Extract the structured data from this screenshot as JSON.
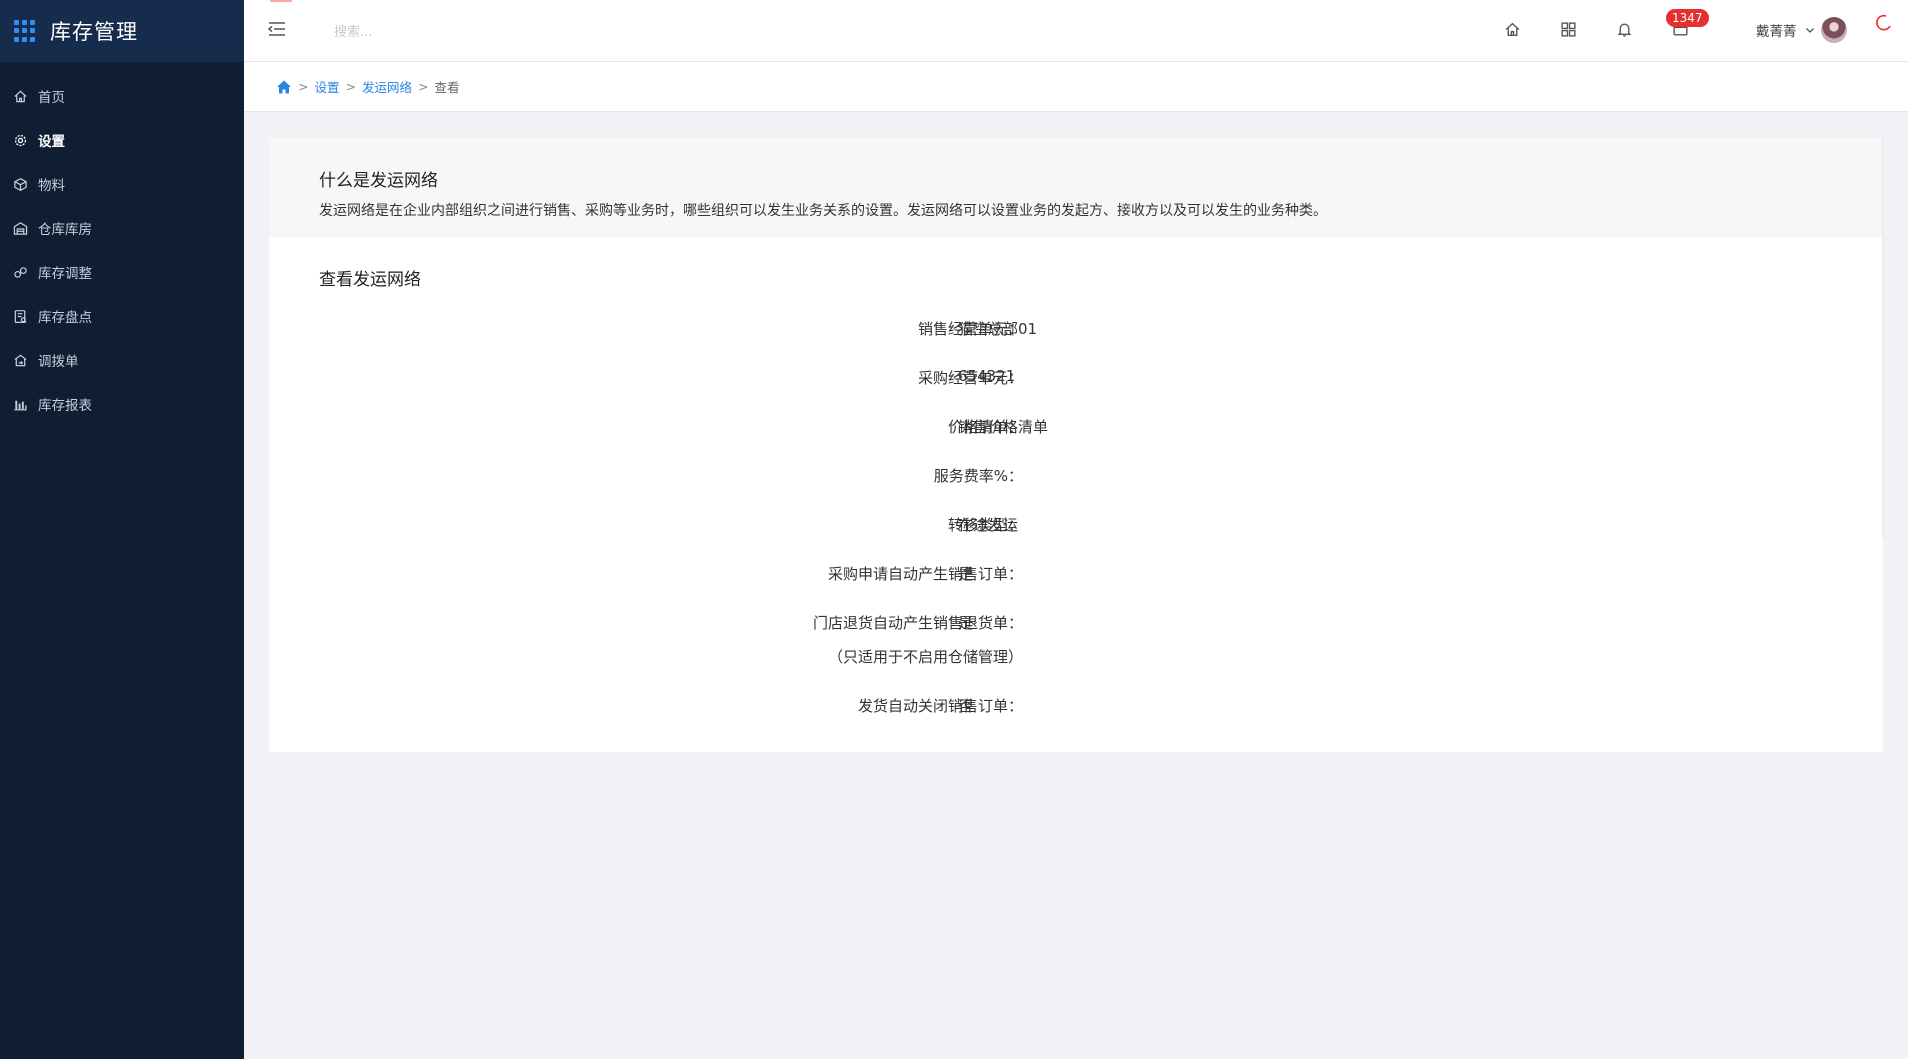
{
  "app": {
    "title": "库存管理"
  },
  "sidebar": {
    "items": [
      {
        "label": "首页",
        "icon": "home-icon",
        "active": false
      },
      {
        "label": "设置",
        "icon": "gear-icon",
        "active": true
      },
      {
        "label": "物料",
        "icon": "cube-icon",
        "active": false
      },
      {
        "label": "仓库库房",
        "icon": "warehouse-icon",
        "active": false
      },
      {
        "label": "库存调整",
        "icon": "adjust-icon",
        "active": false
      },
      {
        "label": "库存盘点",
        "icon": "inventory-check-icon",
        "active": false
      },
      {
        "label": "调拨单",
        "icon": "transfer-icon",
        "active": false
      },
      {
        "label": "库存报表",
        "icon": "bar-chart-icon",
        "active": false
      }
    ]
  },
  "topbar": {
    "search_placeholder": "搜索...",
    "notification_badge": "1347",
    "user_name": "戴菁菁"
  },
  "breadcrumb": {
    "items": [
      "设置",
      "发运网络"
    ],
    "current": "查看"
  },
  "info": {
    "title": "什么是发运网络",
    "description": "发运网络是在企业内部组织之间进行销售、采购等业务时，哪些组织可以发生业务关系的设置。发运网络可以设置业务的发起方、接收方以及可以发生的业务种类。"
  },
  "detail": {
    "title": "查看发运网络",
    "rows": [
      {
        "label": "销售经营单元：",
        "value": "猫空总部01"
      },
      {
        "label": "采购经营单元：",
        "value": "654321"
      },
      {
        "label": "价格清单：",
        "value": "销售价格清单"
      },
      {
        "label": "服务费率%：",
        "value": ""
      },
      {
        "label": "转移类型：",
        "value": "在途发运"
      },
      {
        "label": "采购申请自动产生销售订单：",
        "value": "是"
      },
      {
        "label": "门店退货自动产生销售退货单：",
        "sublabel": "（只适用于不启用仓储管理）",
        "value": "是"
      },
      {
        "label": "发货自动关闭销售订单：",
        "value": "否"
      }
    ]
  },
  "colors": {
    "sidebar_bg": "#0f1e33",
    "brand_bg": "#162c4d",
    "accent": "#2b83e6",
    "badge": "#e62f2f"
  }
}
